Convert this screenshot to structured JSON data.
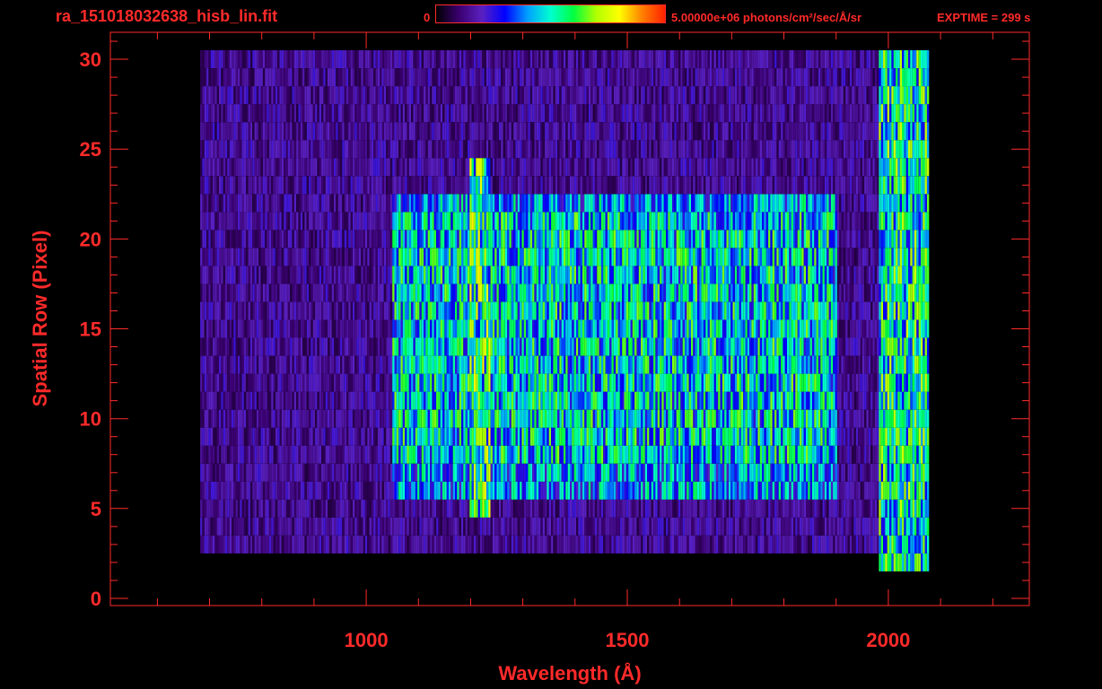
{
  "header": {
    "file_name": "ra_151018032638_hisb_lin.fit",
    "colorbar_min": "0",
    "colorbar_max": "5.00000e+06 photons/cm²/sec/Å/sr",
    "exptime": "EXPTIME = 299 s"
  },
  "colors": {
    "axis": "#ff2a2a",
    "background": "#000000",
    "colormap": [
      "#000000",
      "#3a0070",
      "#5a20c0",
      "#0000ff",
      "#00a0ff",
      "#00ffd0",
      "#00ff40",
      "#b0ff00",
      "#ffff00",
      "#ff8000",
      "#ff2000"
    ]
  },
  "chart_data": {
    "type": "heatmap",
    "title": "",
    "xlabel": "Wavelength (Å)",
    "ylabel": "Spatial Row (Pixel)",
    "xlim": [
      510,
      2270
    ],
    "ylim": [
      -0.4,
      31.5
    ],
    "x_ticks": [
      1000,
      1500,
      2000
    ],
    "x_minor_step": 100,
    "y_ticks": [
      0,
      5,
      10,
      15,
      20,
      25,
      30
    ],
    "y_minor_step": 1,
    "value_range": [
      0,
      5000000
    ],
    "value_units": "photons/cm²/sec/Å/sr",
    "grid": false,
    "regions": [
      {
        "name": "detector extent",
        "x": [
          680,
          2075
        ],
        "rows": [
          3,
          30
        ],
        "level": 0.22
      },
      {
        "name": "slit band",
        "x": [
          1050,
          1900
        ],
        "rows": [
          6,
          22
        ],
        "level": 0.48
      },
      {
        "name": "bright slit core",
        "x": [
          1050,
          1890
        ],
        "rows": [
          8,
          21
        ],
        "level": 0.55
      },
      {
        "name": "Lyman-alpha line",
        "x": [
          1195,
          1235
        ],
        "rows": [
          5,
          24
        ],
        "level": 0.65
      },
      {
        "name": "long-wavelength edge",
        "x": [
          1980,
          2075
        ],
        "rows": [
          2,
          30
        ],
        "level": 0.6
      }
    ]
  }
}
